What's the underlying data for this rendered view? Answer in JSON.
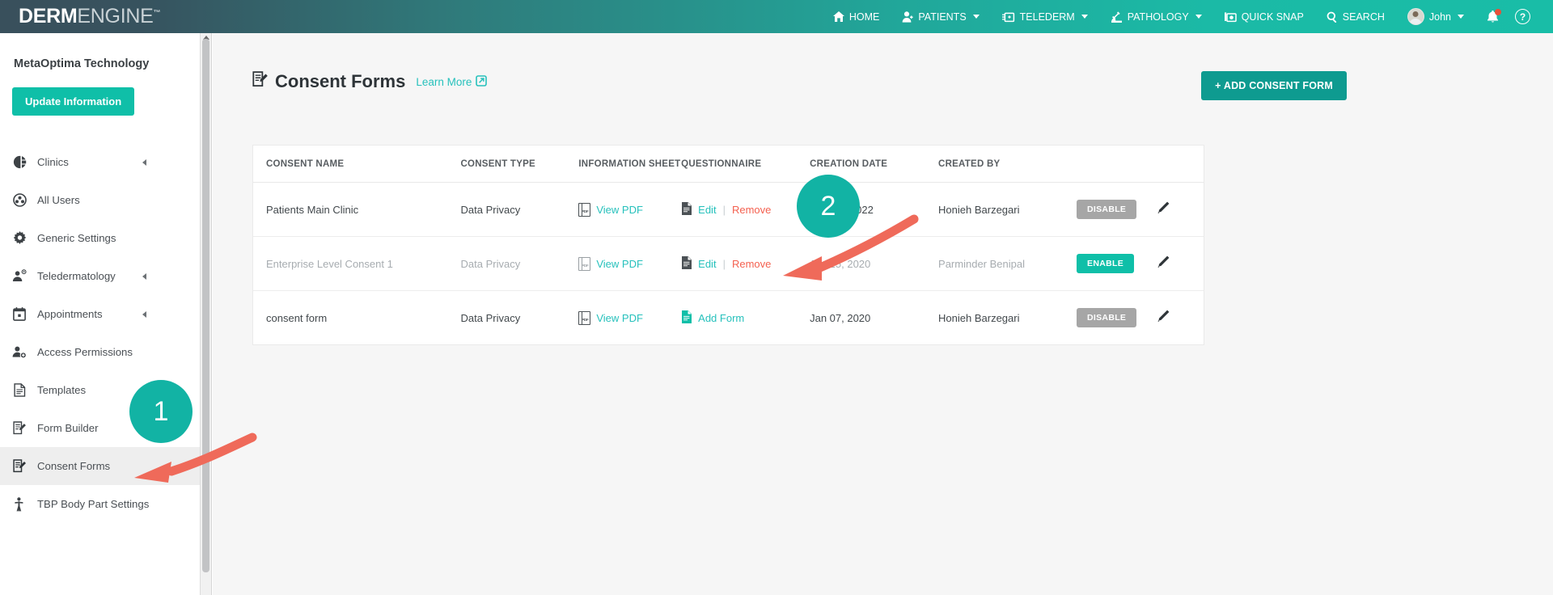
{
  "brand": {
    "name_bold": "DERM",
    "name_light": "ENGINE",
    "trademark": "™"
  },
  "colors": {
    "teal": "#0fbfa8",
    "teal_dark": "#0e9b90",
    "link_teal": "#26c1bc",
    "red": "#f4604f",
    "gray_button": "#a6a6a6",
    "navbar_dark": "#39505c"
  },
  "topnav": {
    "items": [
      {
        "label": "HOME",
        "icon": "home-icon",
        "caret": false
      },
      {
        "label": "PATIENTS",
        "icon": "patients-icon",
        "caret": true
      },
      {
        "label": "TELEDERM",
        "icon": "telederm-icon",
        "caret": true
      },
      {
        "label": "PATHOLOGY",
        "icon": "pathology-icon",
        "caret": true
      },
      {
        "label": "QUICK SNAP",
        "icon": "quick-snap-icon",
        "caret": false
      },
      {
        "label": "SEARCH",
        "icon": "search-icon",
        "caret": false
      }
    ],
    "user": {
      "label": "John",
      "icon": "avatar",
      "caret": true
    },
    "notifications_icon": "bell-icon",
    "help_icon": "help-icon",
    "help_glyph": "?"
  },
  "sidebar": {
    "org_name": "MetaOptima Technology",
    "update_button": "Update Information",
    "items": [
      {
        "label": "Clinics",
        "icon": "clinics-icon",
        "caret": true,
        "active": false
      },
      {
        "label": "All Users",
        "icon": "all-users-icon",
        "caret": false,
        "active": false
      },
      {
        "label": "Generic Settings",
        "icon": "gear-icon",
        "caret": false,
        "active": false
      },
      {
        "label": "Teledermatology",
        "icon": "teledermatology-icon",
        "caret": true,
        "active": false
      },
      {
        "label": "Appointments",
        "icon": "calendar-icon",
        "caret": true,
        "active": false
      },
      {
        "label": "Access Permissions",
        "icon": "access-permissions-icon",
        "caret": false,
        "active": false
      },
      {
        "label": "Templates",
        "icon": "document-icon",
        "caret": false,
        "active": false
      },
      {
        "label": "Form Builder",
        "icon": "form-builder-icon",
        "caret": false,
        "active": false
      },
      {
        "label": "Consent Forms",
        "icon": "consent-forms-icon",
        "caret": false,
        "active": true
      },
      {
        "label": "TBP Body Part Settings",
        "icon": "body-part-icon",
        "caret": false,
        "active": false
      }
    ]
  },
  "main": {
    "page_title": "Consent Forms",
    "page_title_icon": "consent-forms-icon",
    "learn_more": "Learn More",
    "learn_more_icon": "external-link-icon",
    "add_button": "+ ADD CONSENT FORM",
    "table": {
      "headers": [
        "CONSENT NAME",
        "CONSENT TYPE",
        "INFORMATION SHEET",
        "QUESTIONNAIRE",
        "CREATION DATE",
        "CREATED BY"
      ],
      "rows": [
        {
          "consent_name": "Patients Main Clinic",
          "consent_type": "Data Privacy",
          "information_sheet": "View PDF",
          "questionnaire_edit": "Edit",
          "questionnaire_sep": "|",
          "questionnaire_remove": "Remove",
          "questionnaire_mode": "edit-remove",
          "creation_date": "May 02, 2022",
          "created_by": "Honieh Barzegari",
          "toggle_label": "DISABLE",
          "toggle_state": "disable",
          "edit_icon": "pencil-icon",
          "dimmed": false
        },
        {
          "consent_name": "Enterprise Level Consent 1",
          "consent_type": "Data Privacy",
          "information_sheet": "View PDF",
          "questionnaire_edit": "Edit",
          "questionnaire_sep": "|",
          "questionnaire_remove": "Remove",
          "questionnaire_mode": "edit-remove",
          "creation_date": "Jan 25, 2020",
          "created_by": "Parminder Benipal",
          "toggle_label": "ENABLE",
          "toggle_state": "enable",
          "edit_icon": "pencil-icon",
          "dimmed": true
        },
        {
          "consent_name": "consent form",
          "consent_type": "Data Privacy",
          "information_sheet": "View PDF",
          "questionnaire_add": "Add Form",
          "questionnaire_mode": "add-form",
          "creation_date": "Jan 07, 2020",
          "created_by": "Honieh Barzegari",
          "toggle_label": "DISABLE",
          "toggle_state": "disable",
          "edit_icon": "pencil-icon",
          "dimmed": false
        }
      ]
    }
  },
  "annotations": [
    {
      "number": "1",
      "target": "sidebar-item-consent-forms"
    },
    {
      "number": "2",
      "target": "add-form-link"
    }
  ]
}
